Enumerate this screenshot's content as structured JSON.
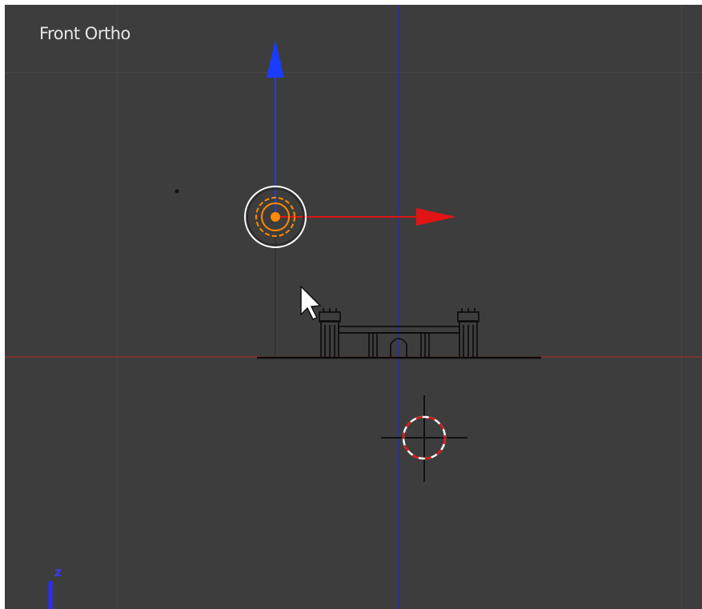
{
  "viewport": {
    "title": "Front Ortho",
    "axis_indicator_label": "z"
  },
  "colors": {
    "background": "#3d3d3d",
    "grid": "#464646",
    "x_axis": "#b52a2a",
    "z_axis": "#2a2ab5",
    "gizmo_x": "#e01414",
    "gizmo_z": "#1a3cff",
    "lamp_selected": "#ff8a00",
    "lamp_ring": "#ffffff"
  },
  "icons": {
    "cursor": "mouse-pointer-icon",
    "lamp": "lamp-object-icon",
    "cursor3d": "3d-cursor-icon"
  }
}
